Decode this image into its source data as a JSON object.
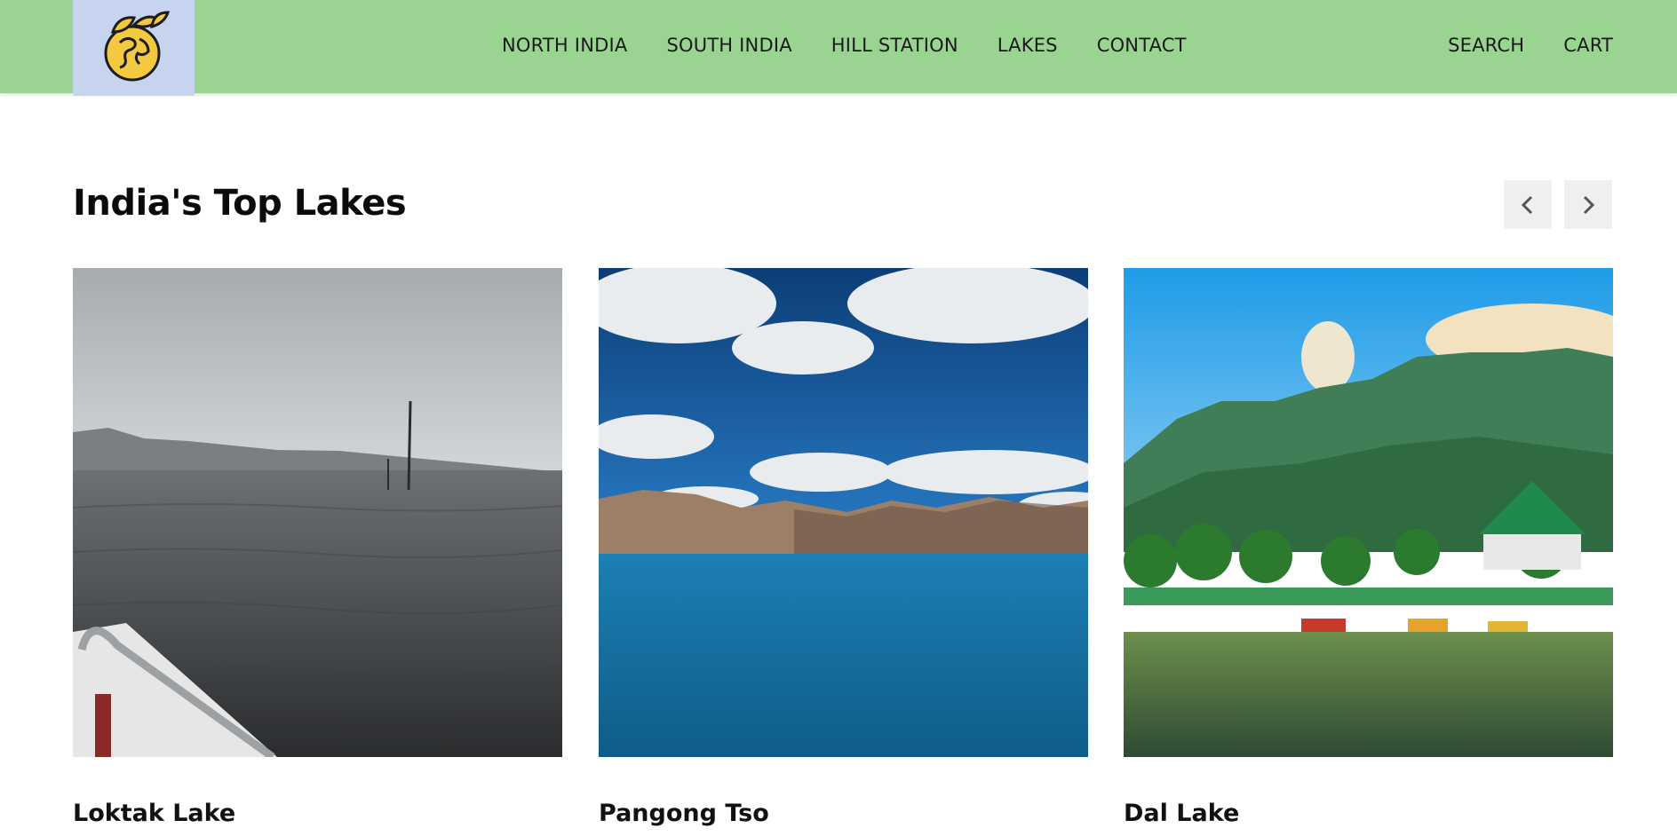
{
  "header": {
    "logo_icon": "globe-with-leaves-icon",
    "nav": [
      {
        "label": "NORTH INDIA"
      },
      {
        "label": "SOUTH INDIA"
      },
      {
        "label": "HILL STATION"
      },
      {
        "label": "LAKES"
      },
      {
        "label": "CONTACT"
      }
    ],
    "utility": {
      "search_label": "SEARCH",
      "cart_label": "CART"
    }
  },
  "section": {
    "title": "India's Top Lakes",
    "prev_icon": "chevron-left-icon",
    "next_icon": "chevron-right-icon"
  },
  "cards": [
    {
      "name": "Loktak Lake"
    },
    {
      "name": "Pangong Tso"
    },
    {
      "name": "Dal Lake"
    }
  ],
  "colors": {
    "header_bg": "#99d590",
    "logo_bg": "#c6d4ef",
    "logo_gold": "#f3c940",
    "button_bg": "#efefef"
  }
}
